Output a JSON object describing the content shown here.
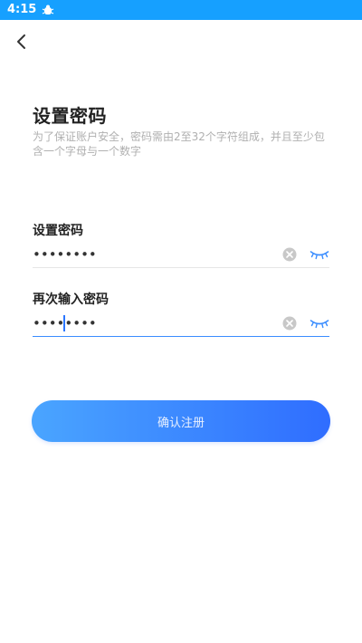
{
  "status_bar": {
    "time": "4:15",
    "bg_color": "#16a0ff",
    "notification_icon": "bug-icon"
  },
  "nav": {
    "back_icon": "chevron-left-icon"
  },
  "page": {
    "title": "设置密码",
    "description": "为了保证账户安全，密码需由2至32个字符组成，并且至少包含一个字母与一个数字"
  },
  "fields": [
    {
      "label": "设置密码",
      "value": "••••••••",
      "focused": false,
      "clear_icon": "clear-circle-icon",
      "toggle_icon": "eye-closed-icon"
    },
    {
      "label": "再次输入密码",
      "value": "••••••••",
      "focused": true,
      "clear_icon": "clear-circle-icon",
      "toggle_icon": "eye-closed-icon"
    }
  ],
  "submit": {
    "label": "确认注册",
    "gradient_start": "#4aa5ff",
    "gradient_end": "#2f6dff"
  },
  "colors": {
    "accent": "#3a8dff",
    "title": "#222222",
    "description": "#b0b0b0",
    "icon_gray": "#c8c8c8"
  }
}
